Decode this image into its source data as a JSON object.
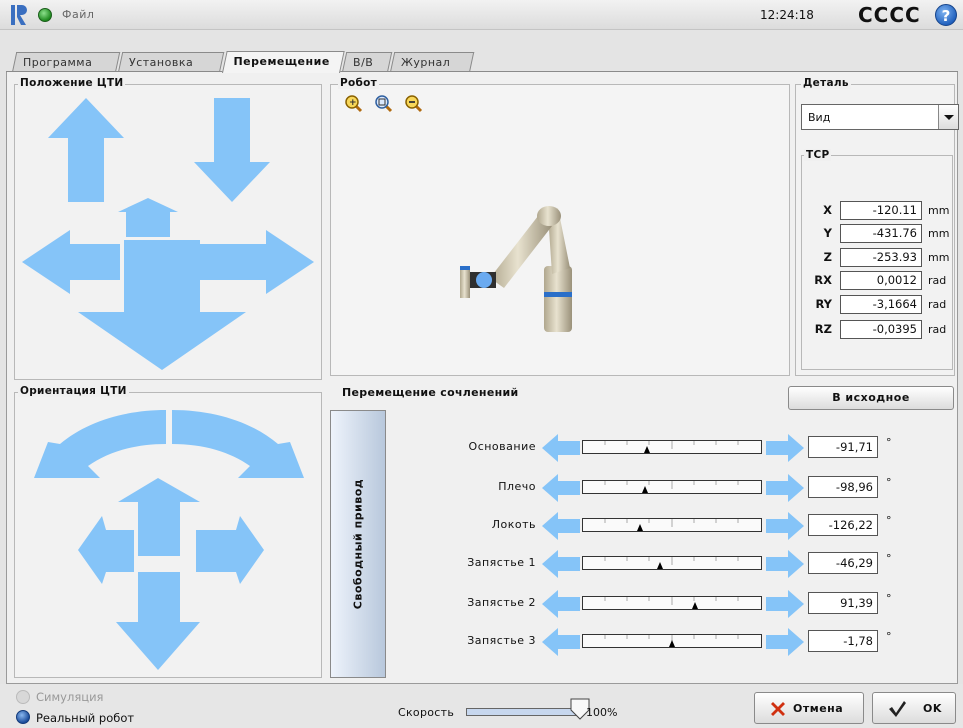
{
  "header": {
    "file_menu": "Файл",
    "clock": "12:24:18",
    "robot_name": "CCCC",
    "help_symbol": "?"
  },
  "tabs": [
    {
      "label": "Программа",
      "active": false
    },
    {
      "label": "Установка",
      "active": false
    },
    {
      "label": "Перемещение",
      "active": true
    },
    {
      "label": "В/В",
      "active": false
    },
    {
      "label": "Журнал",
      "active": false
    }
  ],
  "tcp_position": {
    "title": "Положение ЦТИ"
  },
  "tcp_orientation": {
    "title": "Ориентация ЦТИ"
  },
  "robot_view": {
    "title": "Робот",
    "icons": [
      "zoom-in-icon",
      "zoom-fit-icon",
      "zoom-out-icon"
    ]
  },
  "detail": {
    "title": "Деталь",
    "view_select": "Вид"
  },
  "tcp": {
    "title": "TCP",
    "rows": [
      {
        "label": "X",
        "value": "-120.11",
        "unit": "mm"
      },
      {
        "label": "Y",
        "value": "-431.76",
        "unit": "mm"
      },
      {
        "label": "Z",
        "value": "-253.93",
        "unit": "mm"
      },
      {
        "label": "RX",
        "value": "0,0012",
        "unit": "rad"
      },
      {
        "label": "RY",
        "value": "-3,1664",
        "unit": "rad"
      },
      {
        "label": "RZ",
        "value": "-0,0395",
        "unit": "rad"
      }
    ]
  },
  "joints": {
    "title": "Перемещение сочленений",
    "home_button": "В исходное",
    "freedrive_button": "Свободный привод",
    "degree_symbol": "°",
    "items": [
      {
        "label": "Основание",
        "value": "-91,71",
        "marker_fraction": 0.36
      },
      {
        "label": "Плечо",
        "value": "-98,96",
        "marker_fraction": 0.35
      },
      {
        "label": "Локоть",
        "value": "-126,22",
        "marker_fraction": 0.32
      },
      {
        "label": "Запястье 1",
        "value": "-46,29",
        "marker_fraction": 0.43
      },
      {
        "label": "Запястье 2",
        "value": "91,39",
        "marker_fraction": 0.63
      },
      {
        "label": "Запястье 3",
        "value": "-1,78",
        "marker_fraction": 0.5
      }
    ]
  },
  "footer": {
    "simulation_label": "Симуляция",
    "real_robot_label": "Реальный робот",
    "speed_label": "Скорость",
    "speed_percent": 100,
    "speed_text": "100%",
    "cancel_button": "Отмена",
    "ok_button": "OK"
  },
  "colors": {
    "arrow": "#85c4f8",
    "accent": "#1d5dbb",
    "status_green": "#1f8a1f"
  }
}
